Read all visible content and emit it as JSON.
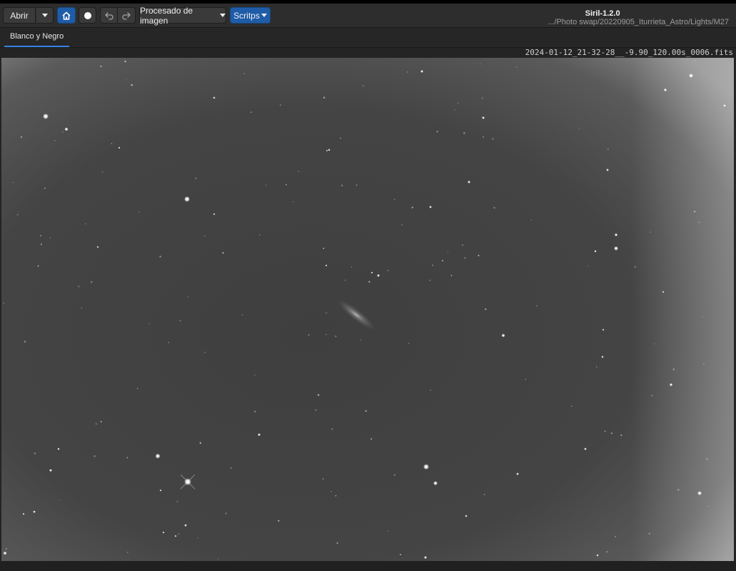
{
  "toolbar": {
    "open_label": "Abrir",
    "processing_label": "Procesado de imagen",
    "scripts_label": "Scritps",
    "icons": {
      "open_recent": "chevron-down-icon",
      "home": "home-icon",
      "live_stack": "record-icon",
      "undo": "undo-icon",
      "redo": "redo-icon"
    }
  },
  "window": {
    "title": "Siril-1.2.0",
    "path": ".../Photo swap/20220905_Iturrieta_Astro/Lights/M27"
  },
  "tabs": [
    {
      "label": "Blanco y Negro",
      "active": true
    }
  ],
  "image": {
    "filename": "2024-01-12_21-32-28__-9.90_120.00s_0006.fits",
    "colors": {
      "sky": "#424242",
      "vignette_edge": "#8a8a8a",
      "star": "#ffffff"
    }
  }
}
